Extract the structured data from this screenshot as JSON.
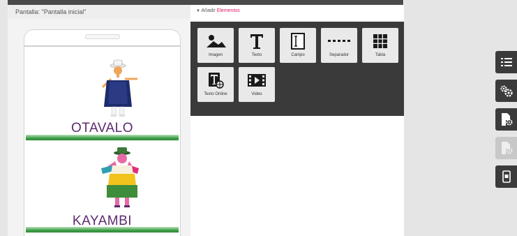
{
  "header": {
    "screen_label": "Pantalla: \"Pantalla inicial\"",
    "add_prefix": "Añadir",
    "add_highlight": "Elementos"
  },
  "cards": [
    {
      "title": "OTAVALO"
    },
    {
      "title": "KAYAMBI"
    }
  ],
  "palette": {
    "tools": [
      {
        "label": "Imagen",
        "icon": "image-icon"
      },
      {
        "label": "Texto",
        "icon": "text-icon"
      },
      {
        "label": "Campo",
        "icon": "field-icon"
      },
      {
        "label": "Separador",
        "icon": "separator-icon"
      },
      {
        "label": "Tabla",
        "icon": "table-icon"
      },
      {
        "label": "Texto Online",
        "icon": "online-text-icon"
      },
      {
        "label": "Video",
        "icon": "video-icon"
      }
    ]
  },
  "side_toolbar": [
    {
      "icon": "list-icon",
      "enabled": true
    },
    {
      "icon": "gears-icon",
      "enabled": true
    },
    {
      "icon": "page-settings-icon",
      "enabled": true
    },
    {
      "icon": "page-settings-disabled-icon",
      "enabled": false
    },
    {
      "icon": "phone-icon",
      "enabled": true
    }
  ],
  "colors": {
    "accent": "#e0176b",
    "dark_panel": "#3a3a3a",
    "title_purple": "#5d2a6e",
    "card_bar_green": "#3f9e47"
  }
}
